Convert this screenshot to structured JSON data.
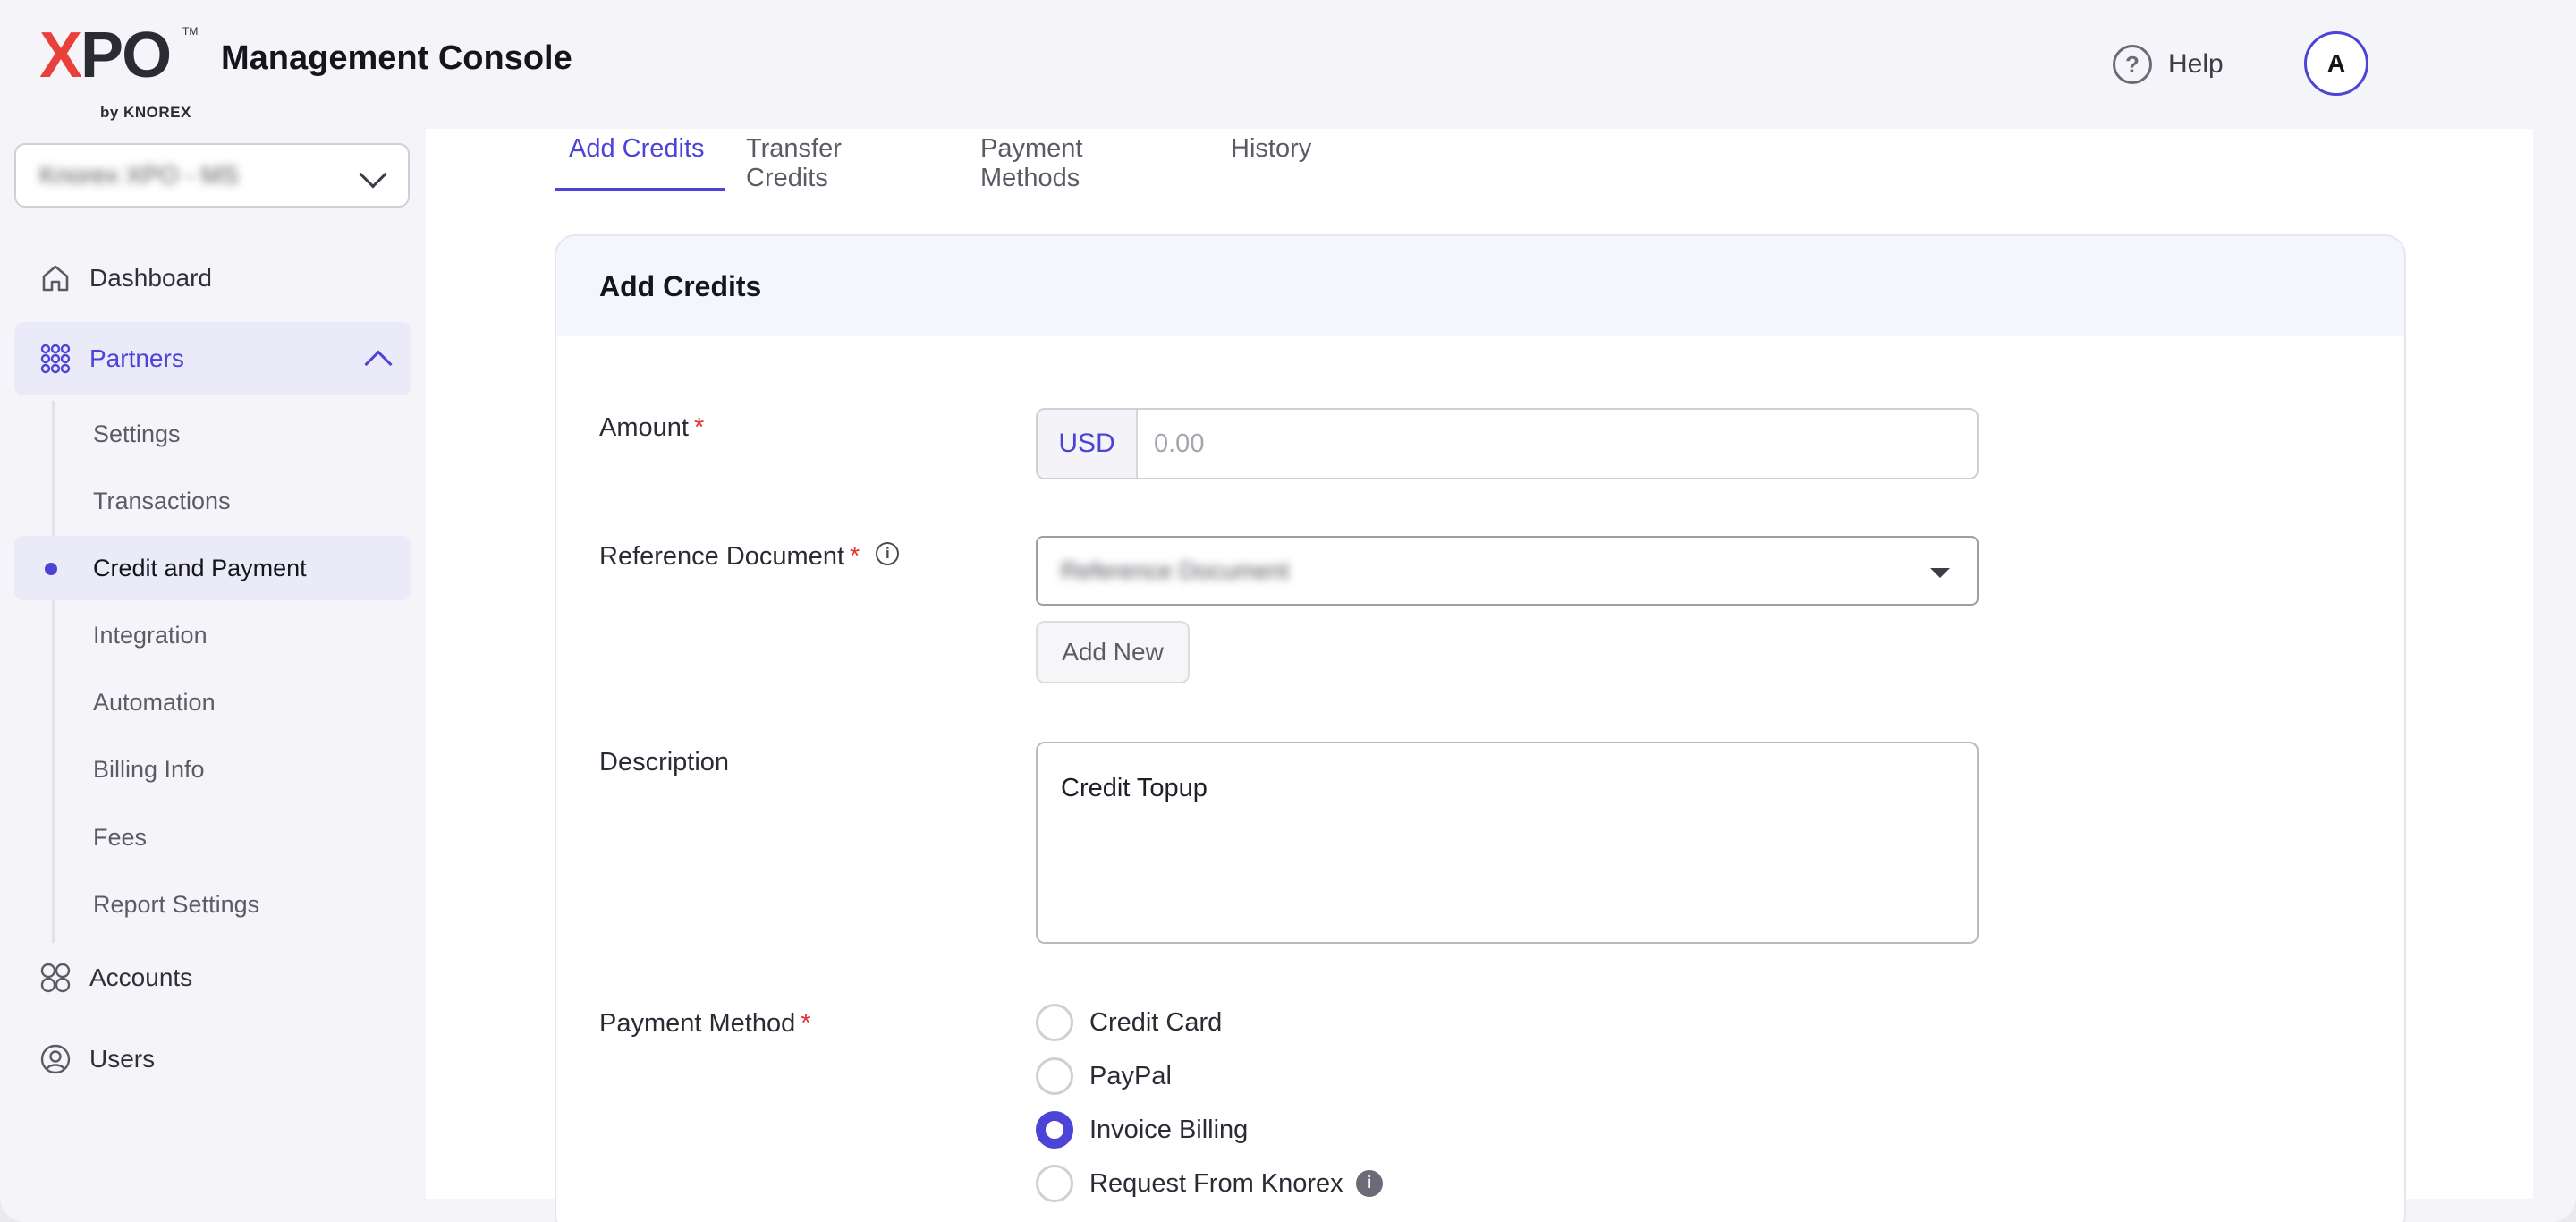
{
  "header": {
    "logo_text": "XPO",
    "logo_tm": "TM",
    "logo_by": "by KNOREX",
    "title": "Management Console",
    "help_label": "Help",
    "avatar_initial": "A"
  },
  "sidebar": {
    "account_select_value": "Knorex XPO - MS",
    "items": [
      {
        "label": "Dashboard",
        "icon": "home-icon"
      },
      {
        "label": "Partners",
        "icon": "grid-dots-icon",
        "expanded": true
      },
      {
        "label": "Accounts",
        "icon": "four-circles-icon"
      },
      {
        "label": "Users",
        "icon": "user-circle-icon"
      }
    ],
    "partners_sub": [
      {
        "label": "Settings"
      },
      {
        "label": "Transactions"
      },
      {
        "label": "Credit and Payment",
        "active": true
      },
      {
        "label": "Integration"
      },
      {
        "label": "Automation"
      },
      {
        "label": "Billing Info"
      },
      {
        "label": "Fees"
      },
      {
        "label": "Report Settings"
      }
    ]
  },
  "tabs": [
    {
      "label": "Add Credits",
      "active": true
    },
    {
      "label": "Transfer Credits"
    },
    {
      "label": "Payment Methods"
    },
    {
      "label": "History"
    }
  ],
  "card": {
    "title": "Add Credits",
    "amount": {
      "label": "Amount",
      "required_mark": "*",
      "currency": "USD",
      "placeholder": "0.00"
    },
    "reference": {
      "label": "Reference Document",
      "required_mark": "*",
      "placeholder": "Reference Document",
      "add_new_label": "Add New"
    },
    "description": {
      "label": "Description",
      "value": "Credit Topup"
    },
    "payment_method": {
      "label": "Payment Method",
      "required_mark": "*",
      "options": [
        {
          "label": "Credit Card",
          "checked": false
        },
        {
          "label": "PayPal",
          "checked": false
        },
        {
          "label": "Invoice Billing",
          "checked": true
        },
        {
          "label": "Request From Knorex",
          "checked": false
        }
      ]
    }
  },
  "colors": {
    "accent": "#4b44d6",
    "required": "#e0322f",
    "active_bg": "#ebeaf9"
  }
}
